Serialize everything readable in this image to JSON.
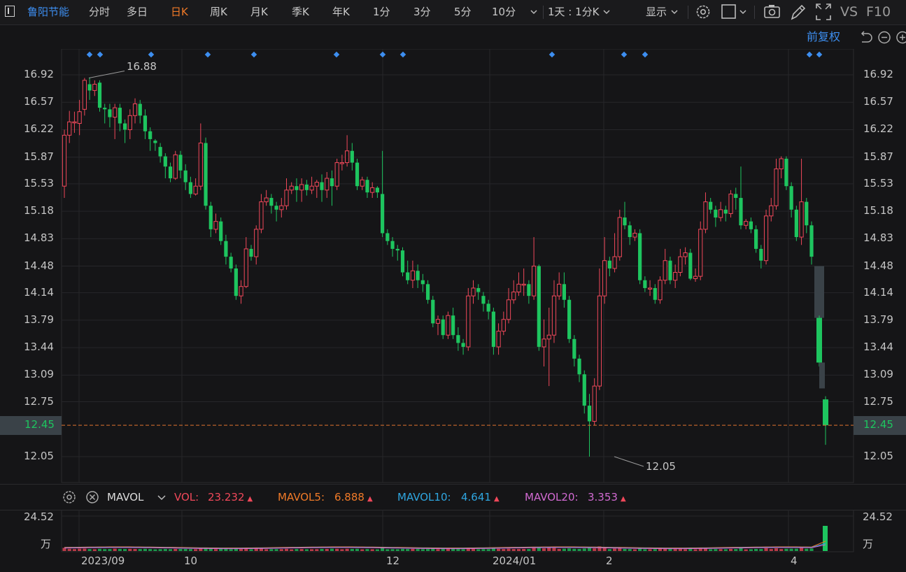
{
  "toolbar": {
    "stock_name": "鲁阳节能",
    "periods": [
      "分时",
      "多日",
      "日K",
      "周K",
      "月K",
      "季K",
      "年K",
      "1分",
      "3分",
      "5分",
      "10分"
    ],
    "active_period": "日K",
    "range_select": "1天 : 1分K",
    "display_label": "显示",
    "vs_label": "VS",
    "f10_label": "F10"
  },
  "subbar": {
    "adjust_label": "前复权"
  },
  "colors": {
    "up": "#f0485a",
    "down": "#1ec55f",
    "accent": "#f07a28",
    "link": "#3d8ef0",
    "background": "#151517"
  },
  "price_axis": {
    "ticks": [
      "16.92",
      "16.57",
      "16.22",
      "15.87",
      "15.53",
      "15.18",
      "14.83",
      "14.48",
      "14.14",
      "13.79",
      "13.44",
      "13.09",
      "12.75",
      "12.05"
    ],
    "current_price": "12.45"
  },
  "annotations": {
    "high_label": "16.88",
    "low_label": "12.05"
  },
  "x_axis_labels": [
    "2023/09",
    "10",
    "12",
    "2024/01",
    "2",
    "4"
  ],
  "indicator": {
    "name": "MAVOL",
    "vol_label": "VOL:",
    "vol_value": "23.232",
    "ma5_label": "MAVOL5:",
    "ma5_value": "6.888",
    "ma10_label": "MAVOL10:",
    "ma10_value": "4.641",
    "ma20_label": "MAVOL20:",
    "ma20_value": "3.353"
  },
  "volume_axis": {
    "top": "24.52",
    "unit": "万"
  },
  "chart_data": {
    "type": "candlestick",
    "ylim": [
      11.9,
      17.15
    ],
    "high": 16.88,
    "low": 12.05,
    "last": 12.45,
    "candles": [
      [
        15.5,
        16.15,
        16.22,
        15.35
      ],
      [
        16.15,
        16.32,
        16.46,
        16.05
      ],
      [
        16.32,
        16.32,
        16.45,
        16.18
      ],
      [
        16.3,
        16.45,
        16.6,
        16.15
      ],
      [
        16.48,
        16.85,
        16.88,
        16.4
      ],
      [
        16.8,
        16.72,
        16.88,
        16.6
      ],
      [
        16.72,
        16.8,
        16.85,
        16.65
      ],
      [
        16.82,
        16.5,
        16.85,
        16.45
      ],
      [
        16.5,
        16.48,
        16.55,
        16.3
      ],
      [
        16.48,
        16.38,
        16.55,
        16.25
      ],
      [
        16.38,
        16.5,
        16.55,
        16.1
      ],
      [
        16.5,
        16.3,
        16.55,
        16.2
      ],
      [
        16.3,
        16.22,
        16.35,
        16.05
      ],
      [
        16.22,
        16.4,
        16.48,
        16.1
      ],
      [
        16.4,
        16.55,
        16.62,
        16.3
      ],
      [
        16.55,
        16.4,
        16.6,
        16.3
      ],
      [
        16.4,
        16.2,
        16.48,
        16.1
      ],
      [
        16.2,
        16.1,
        16.25,
        15.95
      ],
      [
        16.08,
        16.05,
        16.1,
        15.95
      ],
      [
        16.0,
        15.88,
        16.05,
        15.8
      ],
      [
        15.88,
        15.75,
        15.92,
        15.6
      ],
      [
        15.75,
        15.6,
        15.8,
        15.55
      ],
      [
        15.6,
        15.9,
        15.95,
        15.58
      ],
      [
        15.9,
        15.7,
        15.95,
        15.6
      ],
      [
        15.7,
        15.55,
        15.78,
        15.45
      ],
      [
        15.55,
        15.4,
        15.62,
        15.35
      ],
      [
        15.4,
        15.5,
        15.6,
        15.38
      ],
      [
        15.5,
        16.05,
        16.3,
        15.45
      ],
      [
        16.05,
        15.25,
        16.12,
        15.2
      ],
      [
        15.25,
        14.95,
        15.3,
        14.85
      ],
      [
        14.95,
        15.05,
        15.15,
        14.9
      ],
      [
        15.05,
        14.8,
        15.1,
        14.75
      ],
      [
        14.8,
        14.6,
        14.88,
        14.5
      ],
      [
        14.6,
        14.45,
        14.65,
        14.4
      ],
      [
        14.45,
        14.1,
        14.5,
        14.05
      ],
      [
        14.1,
        14.22,
        14.3,
        14.0
      ],
      [
        14.22,
        14.7,
        14.85,
        14.2
      ],
      [
        14.7,
        14.6,
        14.75,
        14.55
      ],
      [
        14.6,
        14.95,
        15.0,
        14.5
      ],
      [
        14.95,
        15.3,
        15.4,
        14.9
      ],
      [
        15.3,
        15.35,
        15.45,
        15.25
      ],
      [
        15.35,
        15.25,
        15.4,
        15.15
      ],
      [
        15.25,
        15.2,
        15.3,
        15.05
      ],
      [
        15.2,
        15.25,
        15.35,
        15.1
      ],
      [
        15.25,
        15.45,
        15.6,
        15.2
      ],
      [
        15.45,
        15.5,
        15.55,
        15.4
      ],
      [
        15.5,
        15.45,
        15.6,
        15.3
      ],
      [
        15.45,
        15.52,
        15.6,
        15.3
      ],
      [
        15.52,
        15.45,
        15.58,
        15.38
      ],
      [
        15.45,
        15.5,
        15.62,
        15.4
      ],
      [
        15.5,
        15.55,
        15.58,
        15.35
      ],
      [
        15.55,
        15.45,
        15.65,
        15.3
      ],
      [
        15.45,
        15.6,
        15.68,
        15.35
      ],
      [
        15.6,
        15.5,
        15.7,
        15.25
      ],
      [
        15.5,
        15.8,
        15.85,
        15.45
      ],
      [
        15.8,
        15.8,
        15.9,
        15.7
      ],
      [
        15.8,
        15.95,
        16.15,
        15.75
      ],
      [
        15.95,
        15.8,
        16.05,
        15.7
      ],
      [
        15.8,
        15.5,
        15.85,
        15.45
      ],
      [
        15.5,
        15.58,
        15.62,
        15.45
      ],
      [
        15.58,
        15.42,
        15.62,
        15.35
      ],
      [
        15.42,
        15.48,
        15.55,
        15.35
      ],
      [
        15.48,
        15.42,
        15.5,
        15.35
      ],
      [
        15.4,
        14.9,
        15.95,
        14.85
      ],
      [
        14.9,
        14.8,
        14.95,
        14.75
      ],
      [
        14.8,
        14.7,
        14.85,
        14.6
      ],
      [
        14.7,
        14.68,
        14.75,
        14.55
      ],
      [
        14.68,
        14.4,
        14.72,
        14.35
      ],
      [
        14.4,
        14.3,
        14.55,
        14.25
      ],
      [
        14.3,
        14.42,
        14.55,
        14.2
      ],
      [
        14.42,
        14.3,
        14.5,
        14.2
      ],
      [
        14.3,
        14.25,
        14.38,
        14.15
      ],
      [
        14.25,
        14.05,
        14.3,
        14.0
      ],
      [
        14.05,
        13.75,
        14.1,
        13.7
      ],
      [
        13.75,
        13.8,
        13.85,
        13.6
      ],
      [
        13.8,
        13.6,
        13.85,
        13.55
      ],
      [
        13.6,
        13.85,
        13.9,
        13.55
      ],
      [
        13.85,
        13.6,
        13.95,
        13.55
      ],
      [
        13.6,
        13.5,
        13.7,
        13.4
      ],
      [
        13.5,
        13.45,
        13.55,
        13.35
      ],
      [
        13.45,
        14.1,
        14.2,
        13.4
      ],
      [
        14.1,
        14.2,
        14.3,
        14.0
      ],
      [
        14.2,
        14.15,
        14.25,
        14.05
      ],
      [
        14.1,
        14.0,
        14.15,
        13.9
      ],
      [
        14.0,
        13.9,
        14.05,
        13.8
      ],
      [
        13.9,
        13.45,
        13.95,
        13.35
      ],
      [
        13.45,
        13.65,
        13.75,
        13.35
      ],
      [
        13.65,
        13.8,
        13.9,
        13.6
      ],
      [
        13.8,
        14.05,
        14.2,
        13.75
      ],
      [
        14.05,
        14.15,
        14.3,
        14.0
      ],
      [
        14.15,
        14.25,
        14.4,
        14.1
      ],
      [
        14.25,
        14.25,
        14.45,
        14.1
      ],
      [
        14.25,
        14.1,
        14.3,
        14.0
      ],
      [
        14.1,
        14.48,
        14.85,
        14.05
      ],
      [
        14.48,
        13.45,
        14.5,
        13.4
      ],
      [
        13.45,
        13.55,
        13.8,
        13.2
      ],
      [
        13.55,
        13.6,
        13.95,
        12.95
      ],
      [
        13.6,
        14.1,
        14.3,
        13.5
      ],
      [
        14.1,
        14.25,
        14.4,
        14.05
      ],
      [
        14.25,
        14.05,
        14.4,
        13.95
      ],
      [
        14.05,
        13.55,
        14.1,
        13.5
      ],
      [
        13.55,
        13.3,
        13.6,
        13.2
      ],
      [
        13.3,
        13.1,
        13.35,
        13.0
      ],
      [
        13.1,
        12.7,
        13.15,
        12.6
      ],
      [
        12.7,
        12.5,
        12.85,
        12.05
      ],
      [
        12.5,
        12.95,
        13.05,
        12.45
      ],
      [
        12.95,
        14.1,
        14.45,
        12.9
      ],
      [
        14.1,
        14.55,
        14.85,
        14.0
      ],
      [
        14.55,
        14.45,
        14.6,
        14.35
      ],
      [
        14.45,
        14.6,
        14.9,
        14.4
      ],
      [
        14.6,
        15.1,
        15.2,
        14.55
      ],
      [
        15.1,
        15.0,
        15.3,
        14.95
      ],
      [
        15.0,
        14.85,
        15.05,
        14.75
      ],
      [
        14.85,
        14.9,
        14.95,
        14.8
      ],
      [
        14.9,
        14.3,
        14.95,
        14.25
      ],
      [
        14.3,
        14.2,
        14.35,
        14.15
      ],
      [
        14.2,
        14.2,
        14.3,
        14.1
      ],
      [
        14.2,
        14.05,
        14.25,
        14.0
      ],
      [
        14.05,
        14.3,
        14.35,
        14.0
      ],
      [
        14.3,
        14.55,
        14.7,
        14.25
      ],
      [
        14.55,
        14.3,
        14.6,
        14.25
      ],
      [
        14.3,
        14.4,
        14.5,
        14.2
      ],
      [
        14.4,
        14.6,
        14.7,
        14.35
      ],
      [
        14.6,
        14.65,
        14.72,
        14.5
      ],
      [
        14.65,
        14.32,
        14.7,
        14.3
      ],
      [
        14.32,
        14.35,
        14.45,
        14.28
      ],
      [
        14.35,
        14.95,
        15.05,
        14.3
      ],
      [
        14.95,
        15.3,
        15.42,
        14.9
      ],
      [
        15.3,
        15.2,
        15.35,
        15.15
      ],
      [
        15.2,
        15.1,
        15.25,
        14.98
      ],
      [
        15.1,
        15.2,
        15.3,
        15.05
      ],
      [
        15.2,
        15.15,
        15.25,
        15.05
      ],
      [
        15.15,
        15.4,
        15.45,
        15.1
      ],
      [
        15.4,
        15.35,
        15.48,
        15.2
      ],
      [
        15.35,
        15.0,
        15.75,
        14.95
      ],
      [
        15.0,
        15.05,
        15.08,
        14.95
      ],
      [
        15.05,
        14.95,
        15.1,
        14.9
      ],
      [
        14.95,
        14.7,
        15.0,
        14.65
      ],
      [
        14.7,
        14.55,
        14.75,
        14.45
      ],
      [
        14.55,
        15.12,
        15.2,
        14.5
      ],
      [
        15.12,
        15.25,
        15.35,
        15.05
      ],
      [
        15.25,
        15.72,
        15.85,
        15.2
      ],
      [
        15.72,
        15.85,
        15.88,
        15.6
      ],
      [
        15.85,
        15.5,
        15.88,
        15.45
      ],
      [
        15.5,
        15.2,
        15.55,
        15.1
      ],
      [
        15.2,
        14.85,
        15.25,
        14.8
      ],
      [
        14.85,
        15.3,
        15.85,
        14.75
      ],
      [
        15.3,
        15.0,
        15.35,
        14.9
      ],
      [
        15.0,
        14.6,
        15.05,
        14.5
      ]
    ]
  }
}
